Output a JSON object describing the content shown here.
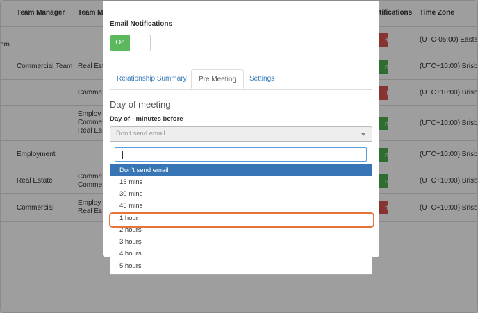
{
  "table": {
    "headers": [
      "Team Manager",
      "Team Me",
      "tifications",
      "Time Zone"
    ],
    "rows": [
      {
        "col0": "om",
        "manager": "",
        "members": [],
        "badge": "ff",
        "badge_state": "off",
        "tz": "(UTC-05:00) Easterr"
      },
      {
        "col0": "",
        "manager": "Commercial Team",
        "members": [
          "Real Esta"
        ],
        "badge": "n",
        "badge_state": "on",
        "tz": "(UTC+10:00) Brisba"
      },
      {
        "col0": "",
        "manager": "",
        "members": [
          "Comme"
        ],
        "badge": "ff",
        "badge_state": "off",
        "tz": "(UTC+10:00) Brisba"
      },
      {
        "col0": "",
        "manager": "",
        "members": [
          "Employ",
          "Comme",
          "Real Es"
        ],
        "badge": "n",
        "badge_state": "on",
        "tz": "(UTC+10:00) Brisba"
      },
      {
        "col0": "",
        "manager": "Employment",
        "members": [],
        "badge": "n",
        "badge_state": "on",
        "tz": "(UTC+10:00) Brisba"
      },
      {
        "col0": "",
        "manager": "Real Estate",
        "members": [
          "Comme",
          "Comme"
        ],
        "badge": "n",
        "badge_state": "on",
        "tz": "(UTC+10:00) Brisba"
      },
      {
        "col0": "",
        "manager": "Commercial",
        "members": [
          "Employ",
          "Real Es"
        ],
        "badge": "ff",
        "badge_state": "off",
        "tz": "(UTC+10:00) Brisba"
      }
    ]
  },
  "modal": {
    "email_notifications_label": "Email Notifications",
    "toggle_label": "On",
    "tabs": [
      {
        "label": "Relationship Summary",
        "active": false
      },
      {
        "label": "Pre Meeting",
        "active": true
      },
      {
        "label": "Settings",
        "active": false
      }
    ],
    "section_heading": "Day of meeting",
    "field_label": "Day of - minutes before",
    "select_value": "Don't send email"
  },
  "dropdown": {
    "search_value": "",
    "options": [
      "Don't send email",
      "15 mins",
      "30 mins",
      "45 mins",
      "1 hour",
      "2 hours",
      "3 hours",
      "4 hours",
      "5 hours"
    ],
    "selected": "Don't send email",
    "highlighted": "1 hour"
  },
  "colors": {
    "on": "#5cb85c",
    "off": "#d9534f",
    "selected_option": "#3875b5",
    "highlight_outline": "#e8743b",
    "link": "#337ab7"
  }
}
